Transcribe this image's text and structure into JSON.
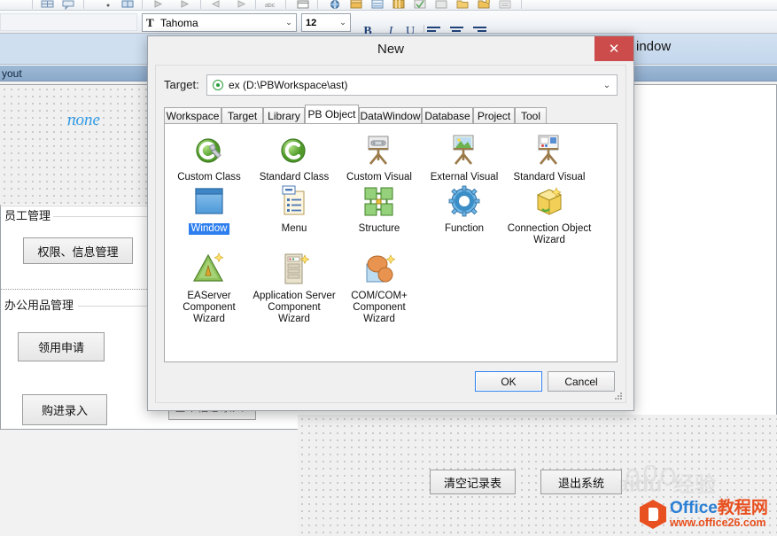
{
  "top_toolbar": {
    "icons": [
      "table-icon",
      "comment-icon",
      "bullet-icon",
      "grid-icon",
      "play-icon",
      "play-step-icon",
      "run-back-icon",
      "run-forward-icon",
      "abc-check-icon",
      "window-icon",
      "globe-icon",
      "database-icon",
      "datawindow-icon",
      "library-icon",
      "pbobject-icon",
      "project-icon",
      "folder-icon",
      "folder-open-icon",
      "properties-icon"
    ]
  },
  "format_toolbar": {
    "font_name": "Tahoma",
    "font_size": "12",
    "bold_label": "B",
    "italic_label": "I",
    "underline_label": "U",
    "align_left": "align-left-icon",
    "align_center": "align-center-icon",
    "align_right": "align-right-icon",
    "font_glyph": "T"
  },
  "background_window": {
    "right_title": "indow",
    "pane_header": "yout",
    "canvas_placeholder": "none",
    "sections": [
      {
        "title": "员工管理"
      },
      {
        "title": "办公用品管理"
      }
    ],
    "buttons": [
      {
        "label": "权限、信息管理"
      },
      {
        "label": "领用申请"
      },
      {
        "label": "购进录入"
      },
      {
        "label": "清空记录表"
      },
      {
        "label": "退出系统"
      }
    ],
    "obscured_button_label": "基本信息录入"
  },
  "dialog": {
    "title": "New",
    "close_label": "✕",
    "target": {
      "label": "Target:",
      "value": "ex (D:\\PBWorkspace\\ast)",
      "arrow": "⌄"
    },
    "tabs": [
      {
        "label": "Workspace",
        "active": false
      },
      {
        "label": "Target",
        "active": false
      },
      {
        "label": "Library",
        "active": false
      },
      {
        "label": "PB Object",
        "active": true
      },
      {
        "label": "DataWindow",
        "active": false
      },
      {
        "label": "Database",
        "active": false
      },
      {
        "label": "Project",
        "active": false
      },
      {
        "label": "Tool",
        "active": false
      }
    ],
    "items": [
      {
        "label": "Custom Class",
        "icon": "custom-class-icon",
        "selected": false
      },
      {
        "label": "Standard Class",
        "icon": "standard-class-icon",
        "selected": false
      },
      {
        "label": "Custom Visual",
        "icon": "custom-visual-icon",
        "selected": false
      },
      {
        "label": "External Visual",
        "icon": "external-visual-icon",
        "selected": false
      },
      {
        "label": "Standard Visual",
        "icon": "standard-visual-icon",
        "selected": false
      },
      {
        "label": "Window",
        "icon": "window-icon",
        "selected": true
      },
      {
        "label": "Menu",
        "icon": "menu-icon",
        "selected": false
      },
      {
        "label": "Structure",
        "icon": "structure-icon",
        "selected": false
      },
      {
        "label": "Function",
        "icon": "function-icon",
        "selected": false
      },
      {
        "label": "Connection Object Wizard",
        "icon": "connection-object-wizard-icon",
        "selected": false
      },
      {
        "label": "EAServer Component Wizard",
        "icon": "easerver-component-wizard-icon",
        "selected": false
      },
      {
        "label": "Application Server Component Wizard",
        "icon": "application-server-component-wizard-icon",
        "selected": false
      },
      {
        "label": "COM/COM+ Component Wizard",
        "icon": "com-component-wizard-icon",
        "selected": false
      }
    ],
    "ok_label": "OK",
    "cancel_label": "Cancel"
  },
  "watermarks": {
    "baidu_text": "aidu 经验",
    "office_line1": "Office教程网",
    "office_line2": "www.office26.com"
  },
  "colors": {
    "accent_blue": "#2d7ff0",
    "close_red": "#cc4b4b",
    "title_blue": "#8aa9ca",
    "orange": "#e8501f"
  }
}
